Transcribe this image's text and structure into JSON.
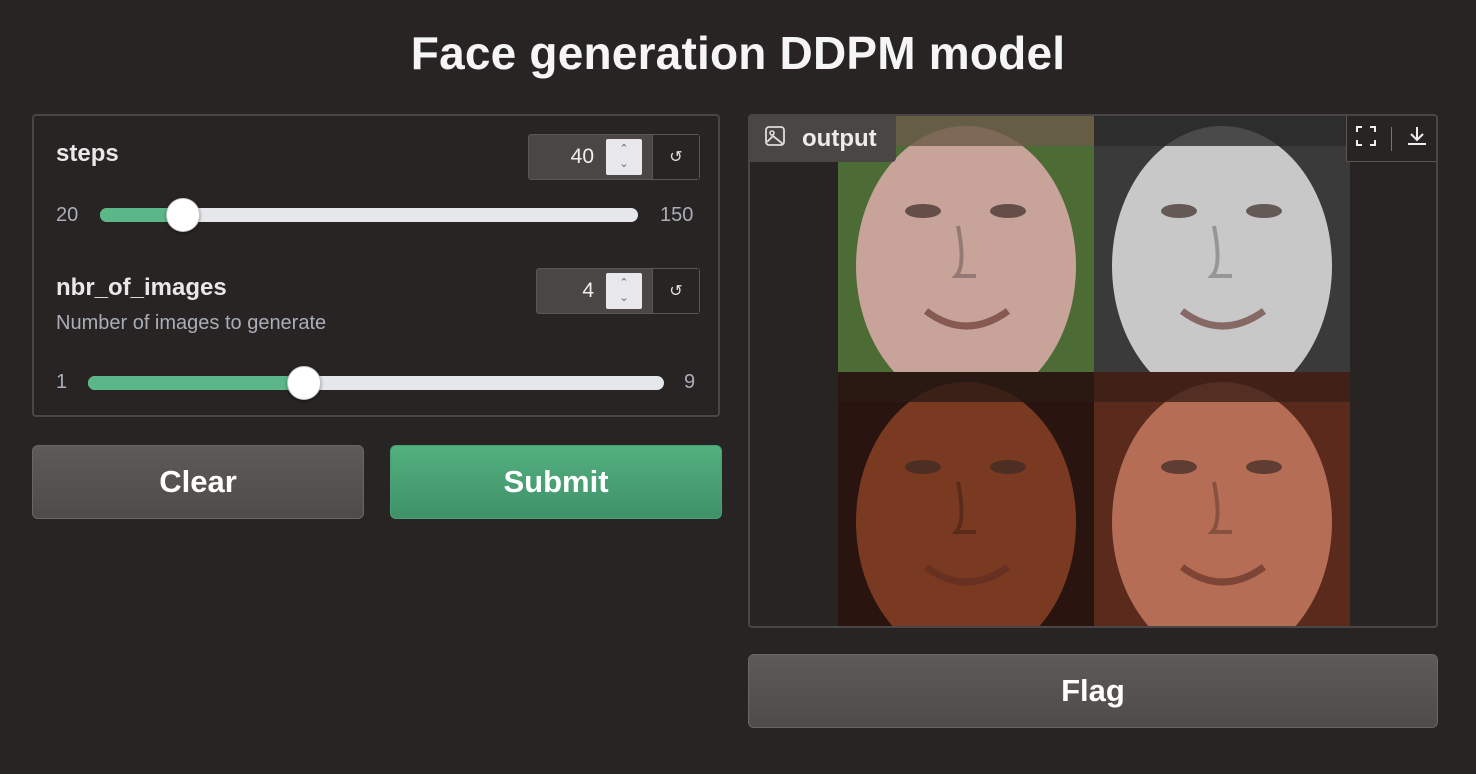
{
  "app": {
    "title": "Face generation DDPM model"
  },
  "steps": {
    "label": "steps",
    "value": "40",
    "min": "20",
    "max": "150",
    "value_num": 40,
    "min_num": 20,
    "max_num": 150
  },
  "nbr_of_images": {
    "label": "nbr_of_images",
    "info": "Number of images to generate",
    "value": "4",
    "min": "1",
    "max": "9",
    "value_num": 4,
    "min_num": 1,
    "max_num": 9
  },
  "buttons": {
    "clear": "Clear",
    "submit": "Submit",
    "flag": "Flag"
  },
  "output": {
    "label": "output",
    "icons": [
      "image-icon",
      "fullscreen-icon",
      "download-icon"
    ],
    "images": [
      {
        "skin": "#c7a39a",
        "bg": "#4d6b35",
        "hair": "#6b5a48"
      },
      {
        "skin": "#c8c8c8",
        "bg": "#3a3a3a",
        "hair": "#2a2a2a"
      },
      {
        "skin": "#7a3a22",
        "bg": "#2a1410",
        "hair": "#2a1a14"
      },
      {
        "skin": "#b56d55",
        "bg": "#5a2a1c",
        "hair": "#3a1e16"
      }
    ]
  },
  "colors": {
    "accent": "#5bb787",
    "primary_button": "#46a174",
    "background": "#272423"
  }
}
